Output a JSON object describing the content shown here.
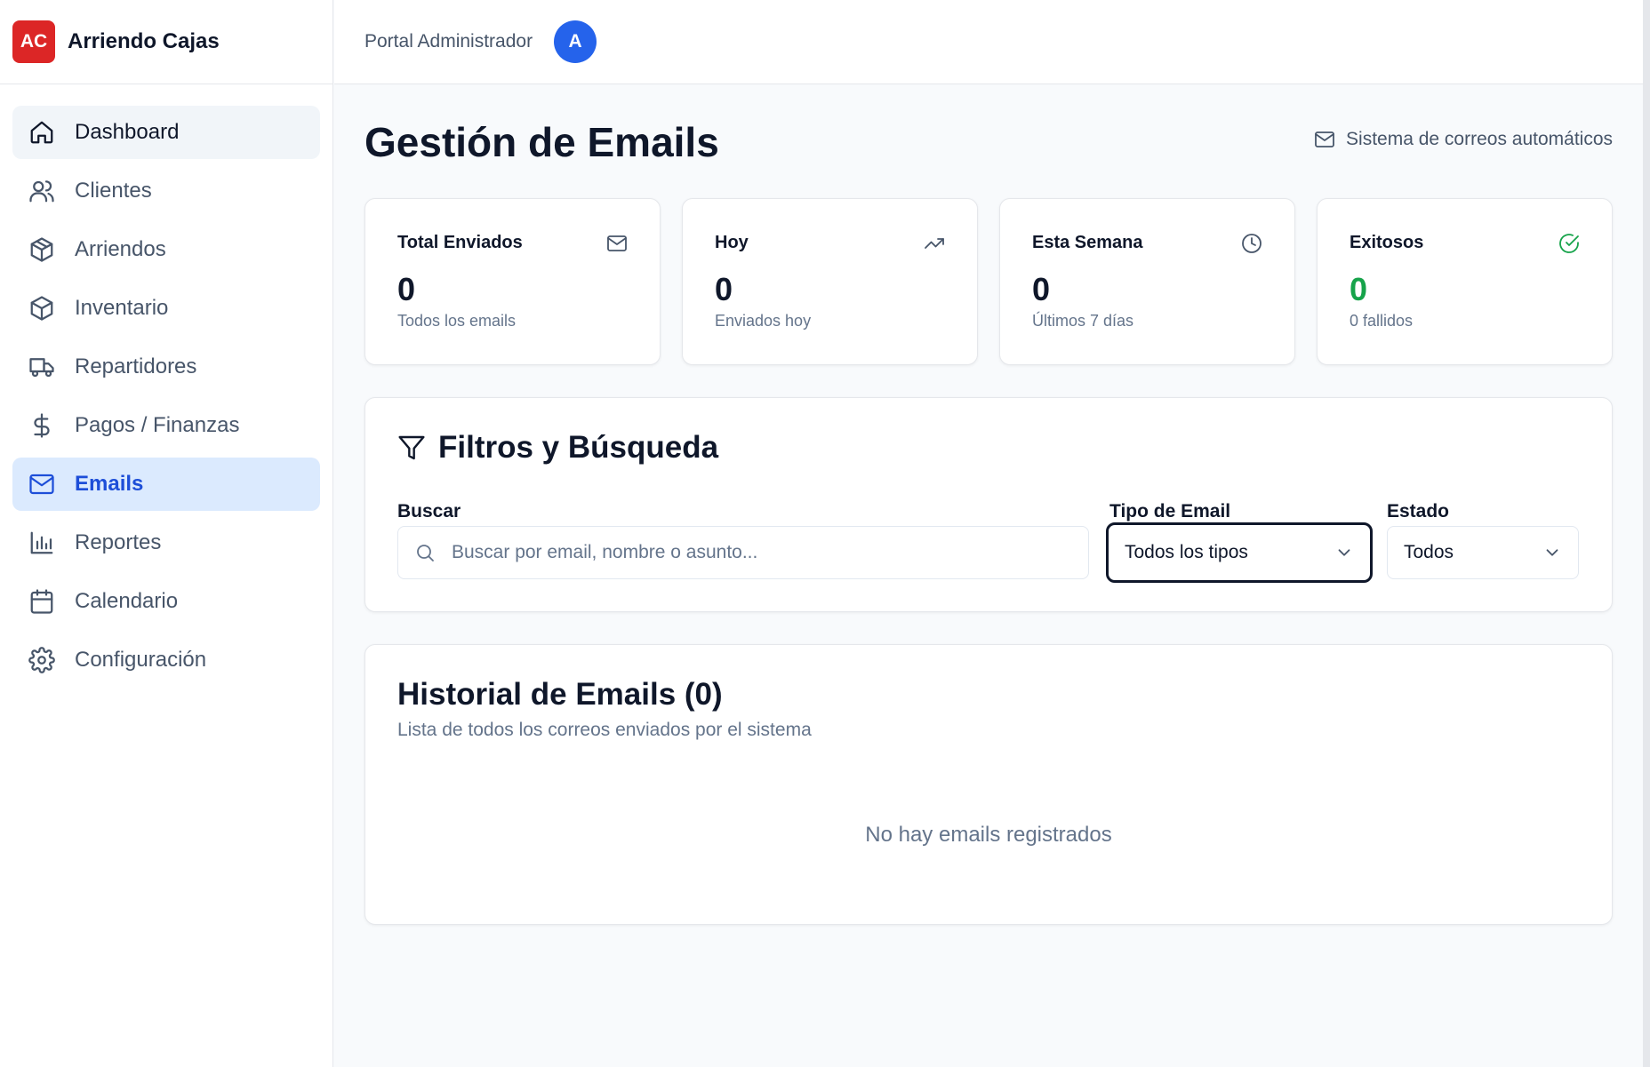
{
  "brand": {
    "logo_text": "AC",
    "name": "Arriendo Cajas"
  },
  "topbar": {
    "portal_label": "Portal Administrador",
    "avatar_initial": "A"
  },
  "sidebar": {
    "items": [
      {
        "label": "Dashboard",
        "icon": "home-icon"
      },
      {
        "label": "Clientes",
        "icon": "users-icon"
      },
      {
        "label": "Arriendos",
        "icon": "box-icon"
      },
      {
        "label": "Inventario",
        "icon": "box-icon"
      },
      {
        "label": "Repartidores",
        "icon": "truck-icon"
      },
      {
        "label": "Pagos / Finanzas",
        "icon": "dollar-icon"
      },
      {
        "label": "Emails",
        "icon": "mail-icon"
      },
      {
        "label": "Reportes",
        "icon": "bar-chart-icon"
      },
      {
        "label": "Calendario",
        "icon": "calendar-icon"
      },
      {
        "label": "Configuración",
        "icon": "gear-icon"
      }
    ]
  },
  "page": {
    "title": "Gestión de Emails",
    "subtitle": "Sistema de correos automáticos"
  },
  "stats": [
    {
      "title": "Total Enviados",
      "value": "0",
      "desc": "Todos los emails",
      "icon": "mail-icon"
    },
    {
      "title": "Hoy",
      "value": "0",
      "desc": "Enviados hoy",
      "icon": "trending-up-icon"
    },
    {
      "title": "Esta Semana",
      "value": "0",
      "desc": "Últimos 7 días",
      "icon": "clock-icon"
    },
    {
      "title": "Exitosos",
      "value": "0",
      "desc": "0 fallidos",
      "icon": "check-circle-icon",
      "value_color": "#16a34a"
    }
  ],
  "filters": {
    "title": "Filtros y Búsqueda",
    "search_label": "Buscar",
    "search_placeholder": "Buscar por email, nombre o asunto...",
    "type_label": "Tipo de Email",
    "type_value": "Todos los tipos",
    "status_label": "Estado",
    "status_value": "Todos"
  },
  "history": {
    "title": "Historial de Emails (0)",
    "subtitle": "Lista de todos los correos enviados por el sistema",
    "empty_text": "No hay emails registrados"
  },
  "colors": {
    "brand": "#dc2626",
    "accent": "#2563eb",
    "selected_bg": "#dbeafe",
    "success": "#16a34a"
  }
}
